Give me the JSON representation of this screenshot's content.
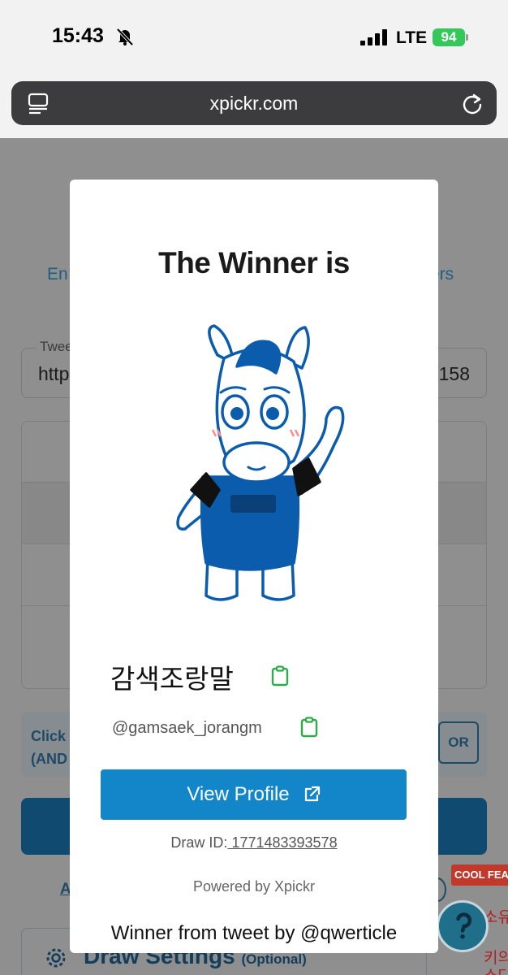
{
  "status_bar": {
    "time": "15:43",
    "network": "LTE",
    "battery": "94"
  },
  "browser": {
    "url": "xpickr.com"
  },
  "background": {
    "tab_left": "En",
    "tab_right": "ers",
    "field_label": "Twee",
    "field_value_left": "http",
    "field_value_right": "158",
    "click_text_line1": "Click",
    "click_text_line2": "(AND",
    "or_button": "OR",
    "link_a": "A",
    "cool_badge": "COOL FEAT",
    "korean_1": "소유",
    "korean_2": "키의",
    "korean_3": "소다",
    "settings_label": "Draw Settings",
    "settings_optional": "(Optional)"
  },
  "modal": {
    "title": "The Winner is",
    "winner_name": "감색조랑말",
    "winner_handle": "@gamsaek_jorangm",
    "view_profile_label": "View Profile",
    "draw_id_label": "Draw ID:",
    "draw_id_value": " 1771483393578",
    "powered_by": "Powered by Xpickr",
    "tweet_by": "Winner from tweet by @qwerticle"
  },
  "colors": {
    "accent": "#1386c9",
    "copy_icon": "#2eaa4a",
    "mascot_blue": "#0b5cad",
    "battery": "#34c759"
  },
  "icons": [
    "bell-slash-icon",
    "signal-icon",
    "tabs-icon",
    "reload-icon",
    "copy-icon",
    "external-link-icon",
    "gear-icon",
    "help-icon"
  ]
}
